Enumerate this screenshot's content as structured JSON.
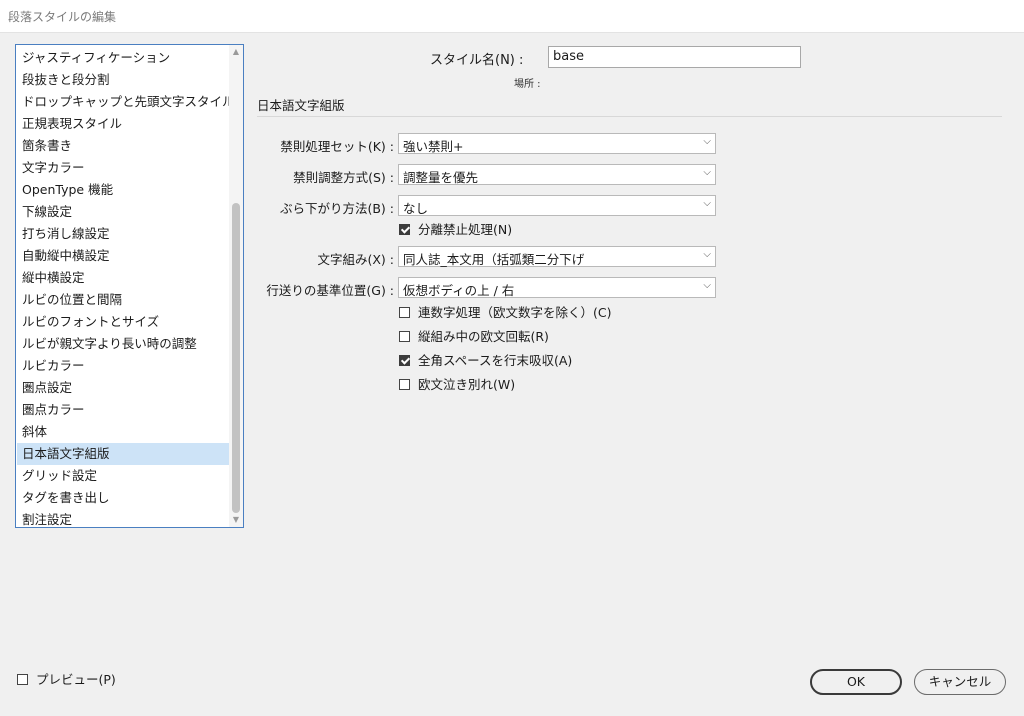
{
  "window": {
    "title": "段落スタイルの編集"
  },
  "sidebar": {
    "items": [
      "ジャスティフィケーション",
      "段抜きと段分割",
      "ドロップキャップと先頭文字スタイル",
      "正規表現スタイル",
      "箇条書き",
      "文字カラー",
      "OpenType 機能",
      "下線設定",
      "打ち消し線設定",
      "自動縦中横設定",
      "縦中横設定",
      "ルビの位置と間隔",
      "ルビのフォントとサイズ",
      "ルビが親文字より長い時の調整",
      "ルビカラー",
      "圏点設定",
      "圏点カラー",
      "斜体",
      "日本語文字組版",
      "グリッド設定",
      "タグを書き出し",
      "割注設定"
    ],
    "selected_index": 18
  },
  "header": {
    "style_name_label": "スタイル名(N) :",
    "style_name_value": "base",
    "location_label": "場所 :"
  },
  "section": {
    "title": "日本語文字組版"
  },
  "fields": {
    "kinsoku_set": {
      "label": "禁則処理セット(K) :",
      "value": "強い禁則+"
    },
    "kinsoku_adjust": {
      "label": "禁則調整方式(S) :",
      "value": "調整量を優先"
    },
    "hanging": {
      "label": "ぶら下がり方法(B) :",
      "value": "なし"
    },
    "mojikumi": {
      "label": "文字組み(X) :",
      "value": "同人誌_本文用（括弧類二分下げ"
    },
    "baseline": {
      "label": "行送りの基準位置(G) :",
      "value": "仮想ボディの上 / 右"
    }
  },
  "checkboxes": {
    "bunri": {
      "label": "分離禁止処理(N)",
      "checked": true
    },
    "renji": {
      "label": "連数字処理（欧文数字を除く）(C)",
      "checked": false
    },
    "rotate": {
      "label": "縦組み中の欧文回転(R)",
      "checked": false
    },
    "zenkaku_space": {
      "label": "全角スペースを行末吸収(A)",
      "checked": true
    },
    "oubun_break": {
      "label": "欧文泣き別れ(W)",
      "checked": false
    }
  },
  "footer": {
    "preview": {
      "label": "プレビュー(P)",
      "checked": false
    },
    "ok_label": "OK",
    "cancel_label": "キャンセル"
  },
  "icons": {
    "dropdown": "chevron-down-icon",
    "scroll_up": "chevron-up-icon",
    "scroll_down": "chevron-down-icon"
  },
  "colors": {
    "selection": "#cde3f7",
    "list_border": "#4a7fc1",
    "background": "#f0f0f0"
  }
}
